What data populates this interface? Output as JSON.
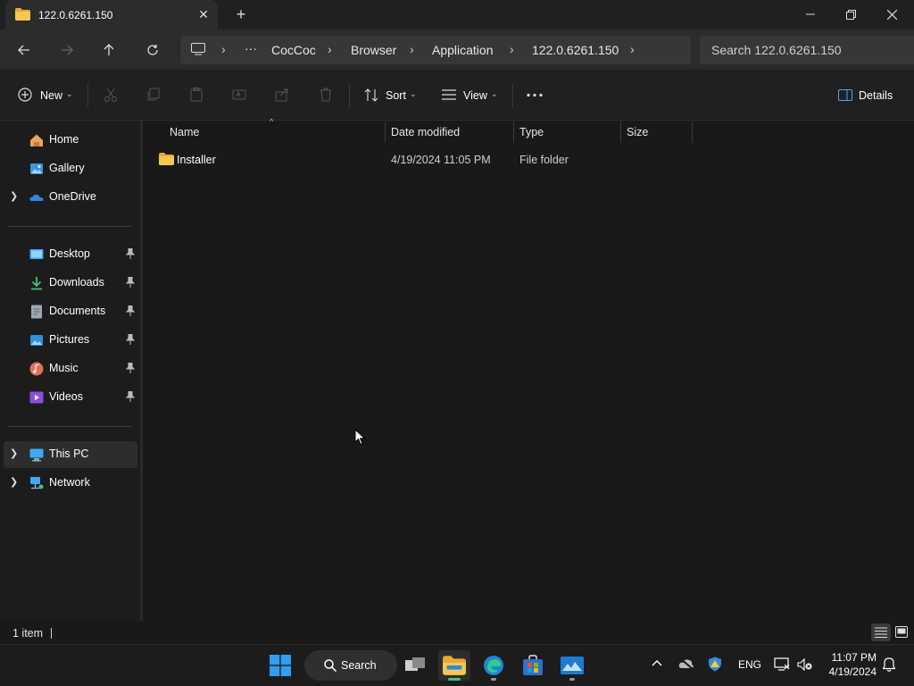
{
  "window": {
    "tab_title": "122.0.6261.150"
  },
  "breadcrumb": {
    "items": [
      "CocCoc",
      "Browser",
      "Application",
      "122.0.6261.150"
    ]
  },
  "search": {
    "placeholder": "Search 122.0.6261.150"
  },
  "toolbar": {
    "new_label": "New",
    "sort_label": "Sort",
    "view_label": "View",
    "details_label": "Details"
  },
  "sidebar": {
    "quick": [
      {
        "label": "Home",
        "icon": "home-icon"
      },
      {
        "label": "Gallery",
        "icon": "gallery-icon"
      },
      {
        "label": "OneDrive",
        "icon": "onedrive-icon"
      }
    ],
    "pinned": [
      {
        "label": "Desktop",
        "icon": "desktop-icon"
      },
      {
        "label": "Downloads",
        "icon": "downloads-icon"
      },
      {
        "label": "Documents",
        "icon": "documents-icon"
      },
      {
        "label": "Pictures",
        "icon": "pictures-icon"
      },
      {
        "label": "Music",
        "icon": "music-icon"
      },
      {
        "label": "Videos",
        "icon": "videos-icon"
      }
    ],
    "devices": [
      {
        "label": "This PC",
        "icon": "this-pc-icon"
      },
      {
        "label": "Network",
        "icon": "network-icon"
      }
    ]
  },
  "table": {
    "columns": [
      "Name",
      "Date modified",
      "Type",
      "Size"
    ],
    "rows": [
      {
        "name": "Installer",
        "date": "4/19/2024 11:05 PM",
        "type": "File folder",
        "size": ""
      }
    ]
  },
  "status": {
    "item_count": "1 item"
  },
  "taskbar": {
    "search_label": "Search",
    "language": "ENG",
    "time": "11:07 PM",
    "date": "4/19/2024"
  },
  "colors": {
    "accent": "#0078d4",
    "folder": "#f3c343"
  }
}
